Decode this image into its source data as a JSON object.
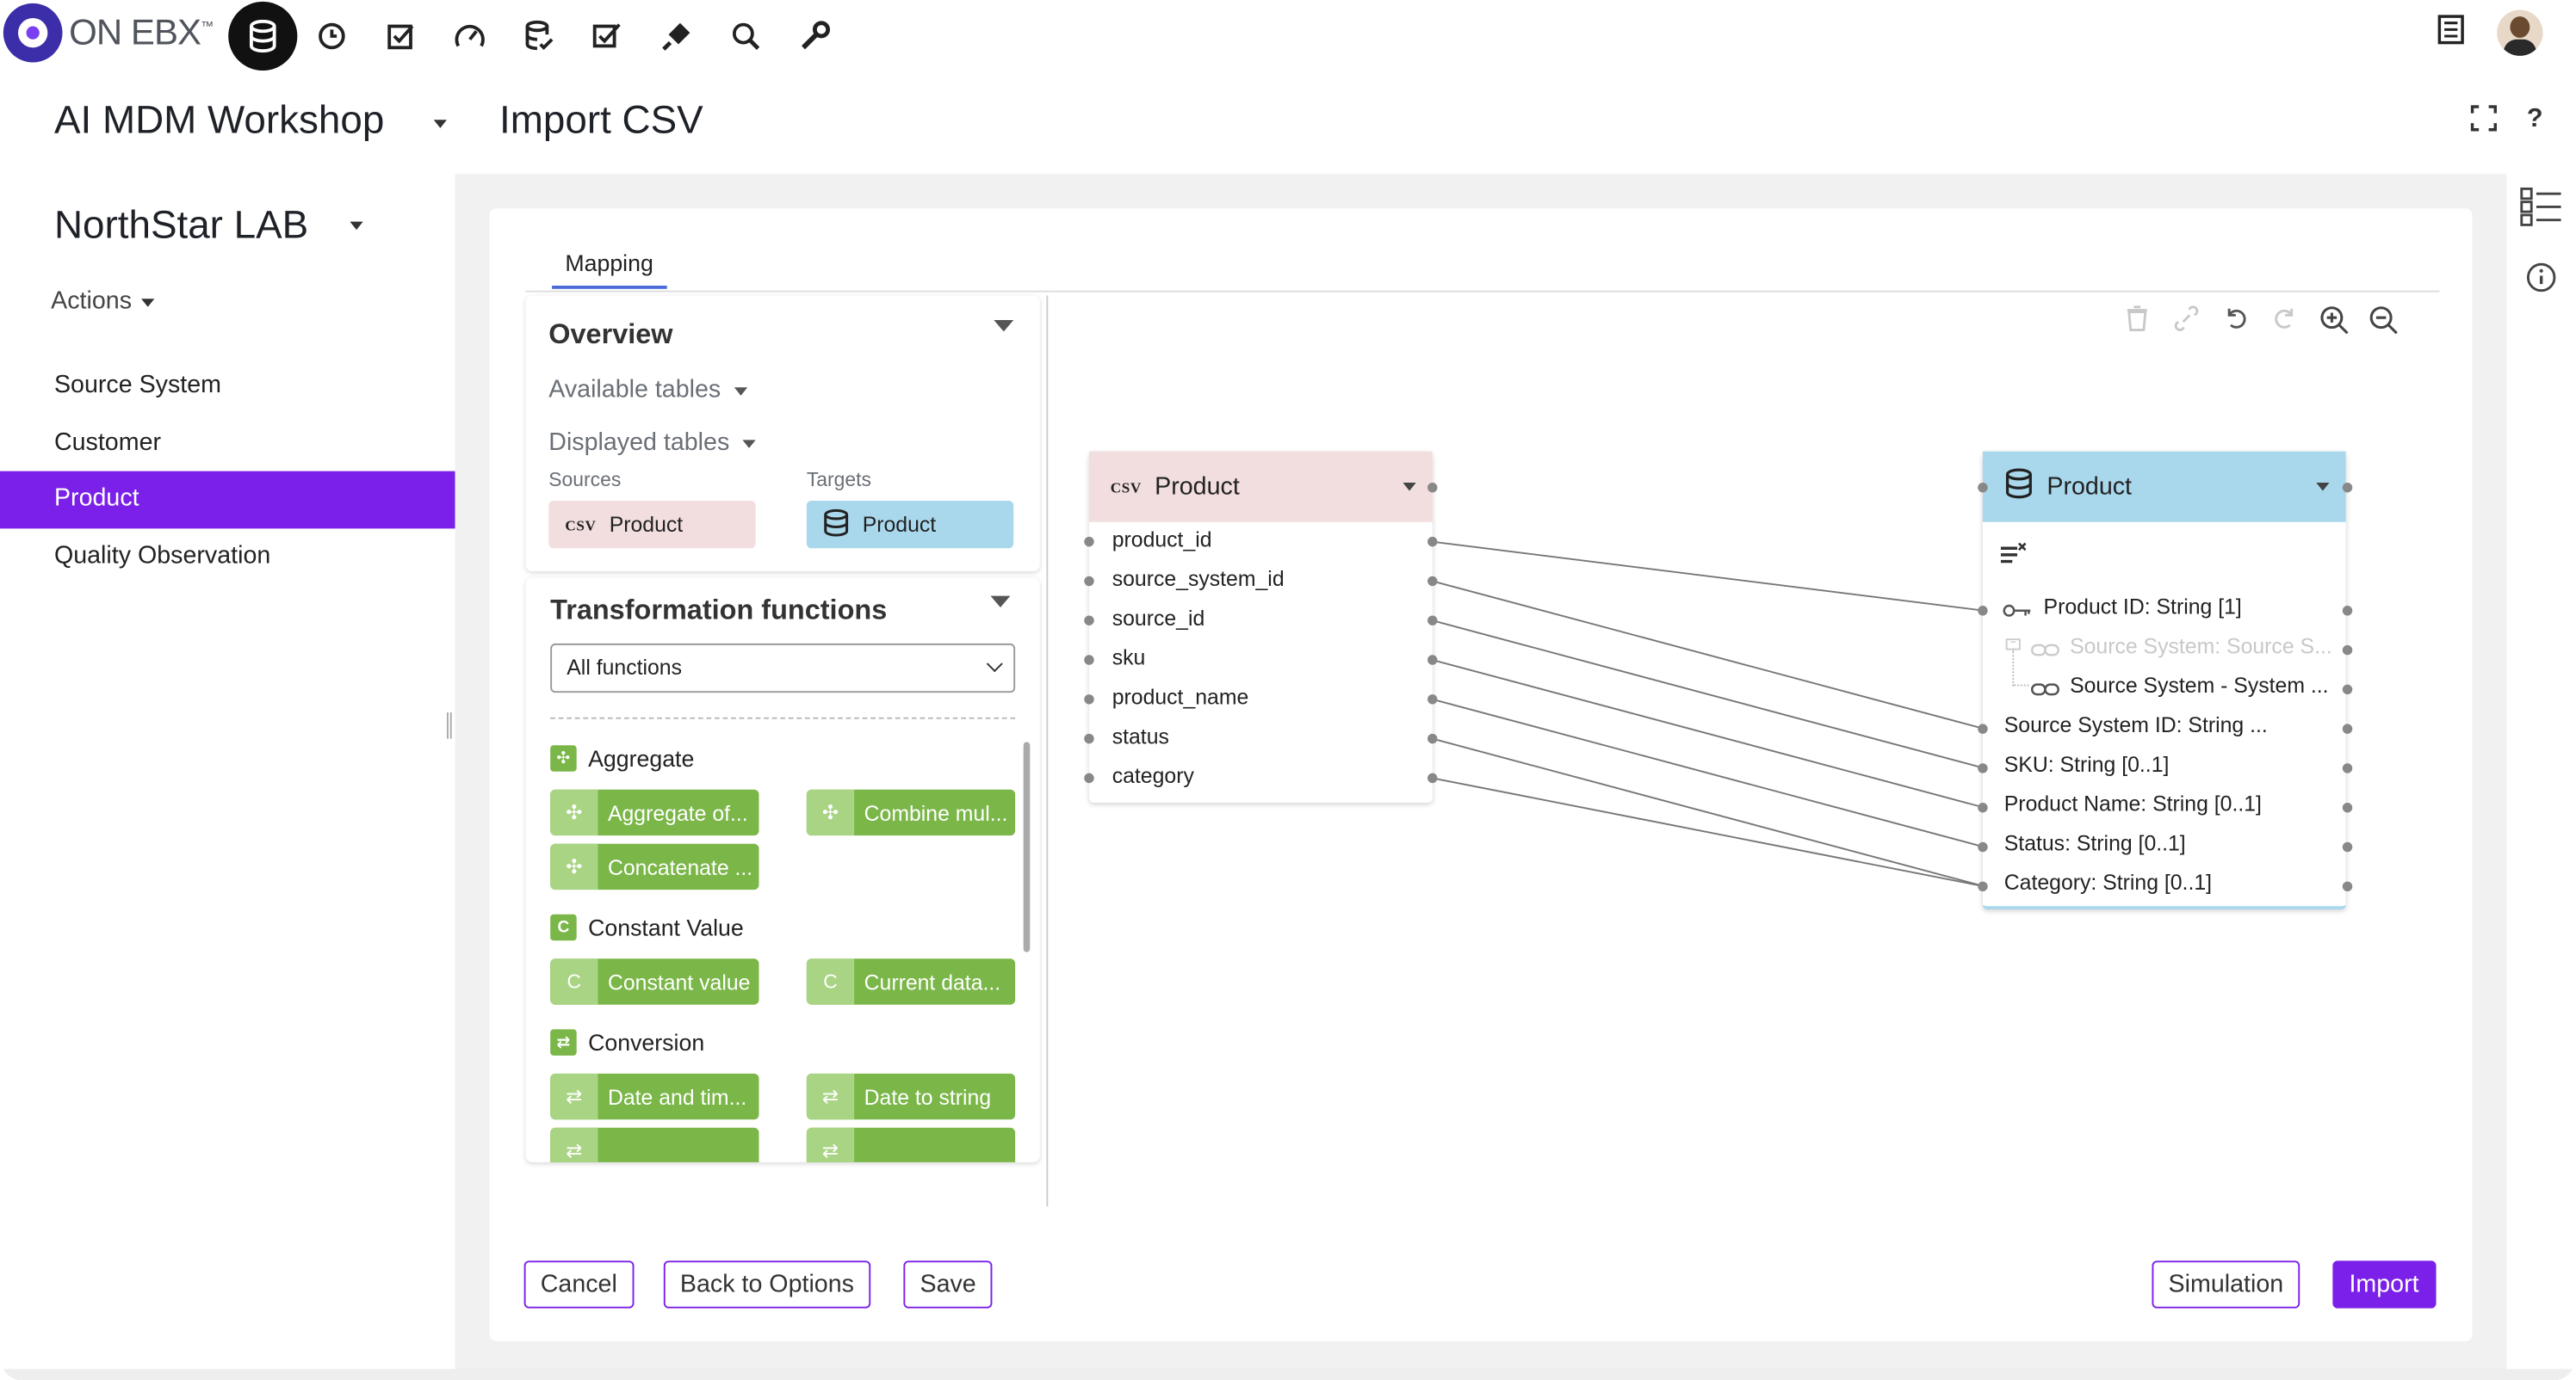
{
  "brand": {
    "logo_text": "ON EBX",
    "tm": "™"
  },
  "topnav": {
    "icons": [
      "database-icon",
      "clock-icon",
      "checkbox-icon",
      "gauge-icon",
      "data-check-icon",
      "tasks-check-icon",
      "plug-icon",
      "search-icon",
      "wrench-icon"
    ]
  },
  "header": {
    "app_title": "AI MDM Workshop",
    "page_title": "Import CSV"
  },
  "sidebar": {
    "title": "NorthStar LAB",
    "actions_label": "Actions",
    "items": [
      {
        "label": "Source System",
        "active": false
      },
      {
        "label": "Customer",
        "active": false
      },
      {
        "label": "Product",
        "active": true
      },
      {
        "label": "Quality Observation",
        "active": false
      }
    ]
  },
  "tabs": {
    "mapping": "Mapping"
  },
  "overview": {
    "title": "Overview",
    "available_tables": "Available tables",
    "displayed_tables": "Displayed tables",
    "sources_label": "Sources",
    "targets_label": "Targets",
    "source_chip": {
      "tag": "CSV",
      "label": "Product"
    },
    "target_chip": {
      "label": "Product"
    }
  },
  "transformations": {
    "title": "Transformation functions",
    "filter_value": "All functions",
    "groups": [
      {
        "label": "Aggregate",
        "icon_char": "✣",
        "functions": [
          "Aggregate of...",
          "Combine mul...",
          "Concatenate ..."
        ]
      },
      {
        "label": "Constant Value",
        "icon_char": "C",
        "functions": [
          "Constant value",
          "Current data..."
        ]
      },
      {
        "label": "Conversion",
        "icon_char": "⇄",
        "functions": [
          "Date and tim...",
          "Date to string"
        ]
      }
    ]
  },
  "source_node": {
    "tag": "CSV",
    "title": "Product",
    "fields": [
      "product_id",
      "source_system_id",
      "source_id",
      "sku",
      "product_name",
      "status",
      "category"
    ]
  },
  "target_node": {
    "title": "Product",
    "fields": [
      {
        "label": "Product ID: String [1]",
        "kind": "key"
      },
      {
        "label": "Source System: Source S...",
        "kind": "link-faded"
      },
      {
        "label": "Source System - System ...",
        "kind": "link"
      },
      {
        "label": "Source System ID: String ...",
        "kind": "plain"
      },
      {
        "label": "SKU: String [0..1]",
        "kind": "plain"
      },
      {
        "label": "Product Name: String [0..1]",
        "kind": "plain"
      },
      {
        "label": "Status: String [0..1]",
        "kind": "plain"
      },
      {
        "label": "Category: String [0..1]",
        "kind": "plain"
      }
    ]
  },
  "mappings": [
    {
      "from": "product_id",
      "to": "Product ID: String [1]"
    },
    {
      "from": "source_system_id",
      "to": "Source System ID: String ..."
    },
    {
      "from": "source_id",
      "to": "Source System ID: String ..."
    },
    {
      "from": "sku",
      "to": "SKU: String [0..1]"
    },
    {
      "from": "product_name",
      "to": "Product Name: String [0..1]"
    },
    {
      "from": "status",
      "to": "Status: String [0..1]"
    },
    {
      "from": "category",
      "to": "Category: String [0..1]"
    }
  ],
  "buttons": {
    "cancel": "Cancel",
    "back": "Back to Options",
    "save": "Save",
    "simulation": "Simulation",
    "import": "Import"
  },
  "colors": {
    "accent": "#7a20e8",
    "source_header": "#f2dede",
    "target_header": "#a9d8ec",
    "function_green": "#7ab648"
  }
}
